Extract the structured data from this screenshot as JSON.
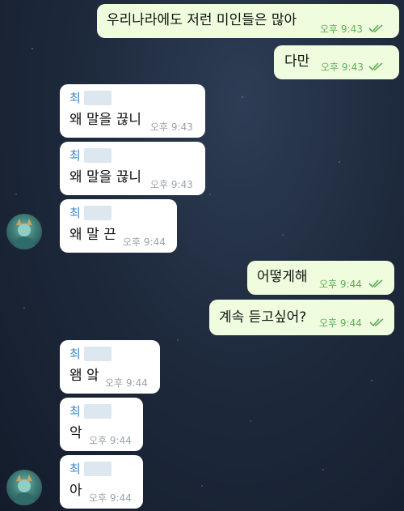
{
  "messages": [
    {
      "text": "우리나라에도 저런 미인들은 많아",
      "time": "오후 9:43"
    },
    {
      "text": "다만",
      "time": "오후 9:43"
    },
    {
      "sender": "최",
      "text": "왜 말을 끊니",
      "time": "오후 9:43"
    },
    {
      "sender": "최",
      "text": "왜 말을 끊니",
      "time": "오후 9:43"
    },
    {
      "sender": "최",
      "text": "왜 말 끈",
      "time": "오후 9:44"
    },
    {
      "text": "어떻게해",
      "time": "오후 9:44"
    },
    {
      "text": "계속 듣고싶어?",
      "time": "오후 9:44"
    },
    {
      "sender": "최",
      "text": "왬 앜",
      "time": "오후 9:44"
    },
    {
      "sender": "최",
      "text": "악",
      "time": "오후 9:44"
    },
    {
      "sender": "최",
      "text": "아",
      "time": "오후 9:44"
    }
  ],
  "colors": {
    "outgoing_bubble": "#effdde",
    "incoming_bubble": "#ffffff",
    "sender_name": "#3e88c4",
    "read_check": "#5fae5a"
  },
  "icons": {
    "read_receipt": "double-check-icon",
    "avatar": "contact-avatar"
  }
}
